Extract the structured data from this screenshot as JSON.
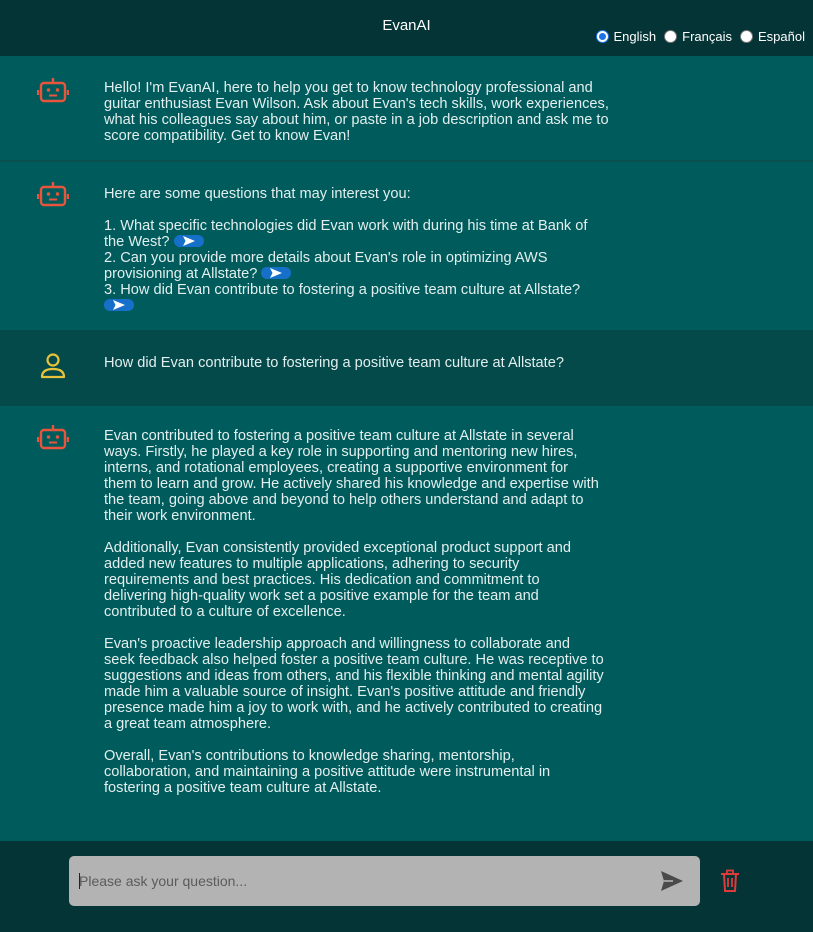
{
  "app": {
    "title": "EvanAI"
  },
  "languages": [
    {
      "label": "English",
      "selected": true
    },
    {
      "label": "Français",
      "selected": false
    },
    {
      "label": "Español",
      "selected": false
    }
  ],
  "colors": {
    "bot_icon": "#e8553d",
    "user_icon": "#e8c23a",
    "accent_blue": "#1670c9",
    "trash": "#e03a3a"
  },
  "messages": {
    "greeting": "Hello! I'm EvanAI, here to help you get to know technology professional and guitar enthusiast Evan Wilson. Ask about Evan's tech skills, work experiences, what his colleagues say about him, or paste in a job description and ask me to score compatibility. Get to know Evan!",
    "suggest_intro": "Here are some questions that may interest you:",
    "suggestions": [
      "1. What specific technologies did Evan work with during his time at Bank of the West?",
      "2. Can you provide more details about Evan's role in optimizing AWS provisioning at Allstate?",
      "3. How did Evan contribute to fostering a positive team culture at Allstate?"
    ],
    "user_question": "How did Evan contribute to fostering a positive team culture at Allstate?",
    "answer": [
      "Evan contributed to fostering a positive team culture at Allstate in several ways. Firstly, he played a key role in supporting and mentoring new hires, interns, and rotational employees, creating a supportive environment for them to learn and grow. He actively shared his knowledge and expertise with the team, going above and beyond to help others understand and adapt to their work environment.",
      "Additionally, Evan consistently provided exceptional product support and added new features to multiple applications, adhering to security requirements and best practices. His dedication and commitment to delivering high-quality work set a positive example for the team and contributed to a culture of excellence.",
      "Evan's proactive leadership approach and willingness to collaborate and seek feedback also helped foster a positive team culture. He was receptive to suggestions and ideas from others, and his flexible thinking and mental agility made him a valuable source of insight. Evan's positive attitude and friendly presence made him a joy to work with, and he actively contributed to creating a great team atmosphere.",
      "Overall, Evan's contributions to knowledge sharing, mentorship, collaboration, and maintaining a positive attitude were instrumental in fostering a positive team culture at Allstate."
    ]
  },
  "input": {
    "placeholder": "Please ask your question...",
    "value": ""
  },
  "icons": {
    "bot": "robot-icon",
    "user": "user-icon",
    "send": "send-icon",
    "clear": "trash-icon"
  }
}
